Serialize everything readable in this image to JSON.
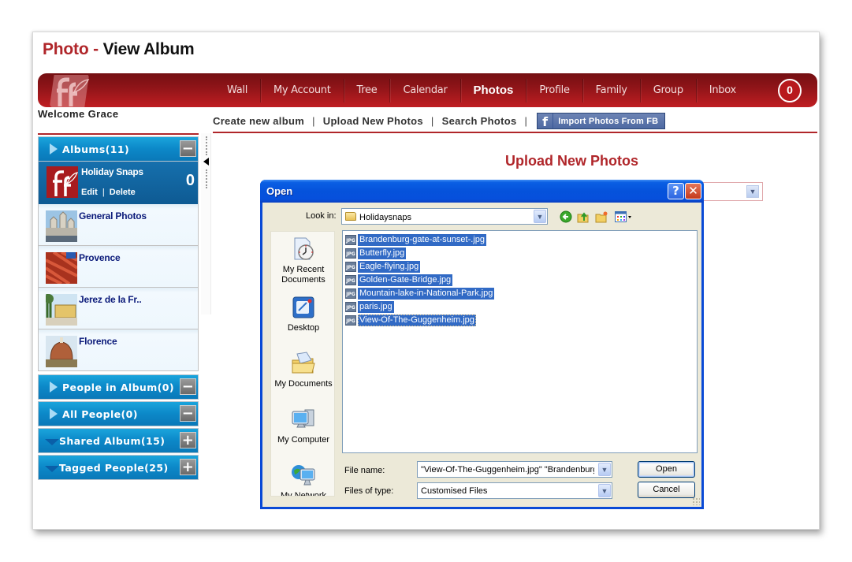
{
  "page": {
    "title_part1": "Photo -",
    "title_part2": "View Album",
    "welcome": "Welcome Grace"
  },
  "nav": {
    "items": [
      {
        "label": "Wall",
        "active": false
      },
      {
        "label": "My Account",
        "active": false
      },
      {
        "label": "Tree",
        "active": false
      },
      {
        "label": "Calendar",
        "active": false
      },
      {
        "label": "Photos",
        "active": true
      },
      {
        "label": "Profile",
        "active": false
      },
      {
        "label": "Family",
        "active": false
      },
      {
        "label": "Group",
        "active": false
      },
      {
        "label": "Inbox",
        "active": false
      }
    ],
    "inbox_count": "0"
  },
  "subnav": {
    "create": "Create new album",
    "upload": "Upload New Photos",
    "search": "Search Photos",
    "separator": "|",
    "fb_icon": "f",
    "fb_import": "Import Photos From FB"
  },
  "sidebar": {
    "albums_header": "Albums(11)",
    "albums_toggle": "−",
    "selected_album": {
      "name": "Holiday Snaps",
      "edit": "Edit",
      "divider": "|",
      "delete": "Delete",
      "count": "0"
    },
    "albums": [
      {
        "name": "General Photos",
        "thumb": "city-thumbnail"
      },
      {
        "name": "Provence",
        "thumb": "peppers-thumbnail"
      },
      {
        "name": "Jerez de la Fr..",
        "thumb": "building-thumbnail"
      },
      {
        "name": "Florence",
        "thumb": "dome-thumbnail"
      }
    ],
    "panels": [
      {
        "label": "People in Album(0)",
        "toggle": "−",
        "arrow": "right"
      },
      {
        "label": "All People(0)",
        "toggle": "−",
        "arrow": "right"
      },
      {
        "label": "Shared Album(15)",
        "toggle": "+",
        "arrow": "down"
      },
      {
        "label": "Tagged People(25)",
        "toggle": "+",
        "arrow": "down"
      }
    ]
  },
  "main": {
    "heading": "Upload New Photos"
  },
  "dialog": {
    "title": "Open",
    "help": "?",
    "close": "✕",
    "look_in_label": "Look in:",
    "look_in_value": "Holidaysnaps",
    "places": [
      {
        "label": "My Recent Documents"
      },
      {
        "label": "Desktop"
      },
      {
        "label": "My Documents"
      },
      {
        "label": "My Computer"
      },
      {
        "label": "My Network"
      }
    ],
    "file_icon_text": "JPG",
    "files": [
      {
        "name": "Brandenburg-gate-at-sunset-.jpg",
        "selected": true,
        "focused": false
      },
      {
        "name": "Butterfly.jpg",
        "selected": true,
        "focused": false
      },
      {
        "name": "Eagle-flying.jpg",
        "selected": true,
        "focused": false
      },
      {
        "name": "Golden-Gate-Bridge.jpg",
        "selected": true,
        "focused": false
      },
      {
        "name": "Mountain-lake-in-National-Park.jpg",
        "selected": true,
        "focused": false
      },
      {
        "name": "paris.jpg",
        "selected": true,
        "focused": false
      },
      {
        "name": "View-Of-The-Guggenheim.jpg",
        "selected": true,
        "focused": true
      }
    ],
    "file_name_label": "File name:",
    "file_name_value": "\"View-Of-The-Guggenheim.jpg\" \"Brandenburg-",
    "file_type_label": "Files of type:",
    "file_type_value": "Customised Files",
    "open_button": "Open",
    "cancel_button": "Cancel"
  },
  "colors": {
    "brand_red": "#b0262a",
    "panel_blue": "#0c88c8",
    "selection_blue": "#316ac5",
    "xp_title_blue": "#0552db"
  }
}
